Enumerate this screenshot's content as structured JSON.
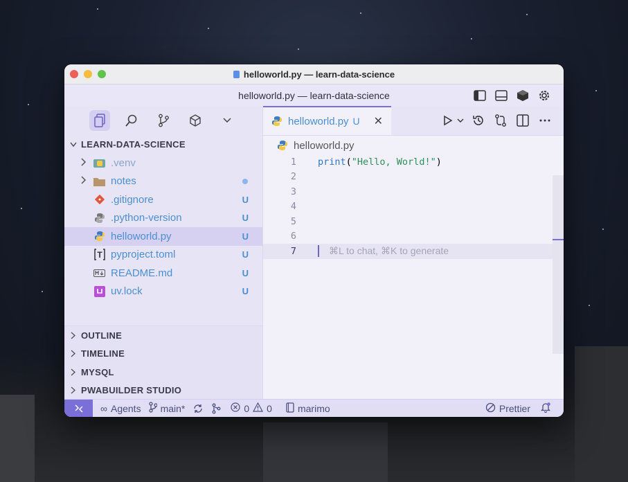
{
  "window": {
    "title": "helloworld.py — learn-data-science"
  },
  "command_center": {
    "label": "helloworld.py — learn-data-science"
  },
  "explorer": {
    "section_title": "LEARN-DATA-SCIENCE",
    "items": [
      {
        "name": ".venv",
        "badge": "",
        "type": "folder"
      },
      {
        "name": "notes",
        "badge": "",
        "type": "folder"
      },
      {
        "name": ".gitignore",
        "badge": "U",
        "type": "file"
      },
      {
        "name": ".python-version",
        "badge": "U",
        "type": "file"
      },
      {
        "name": "helloworld.py",
        "badge": "U",
        "type": "file"
      },
      {
        "name": "pyproject.toml",
        "badge": "U",
        "type": "file"
      },
      {
        "name": "README.md",
        "badge": "U",
        "type": "file"
      },
      {
        "name": "uv.lock",
        "badge": "U",
        "type": "file"
      }
    ],
    "bottom_sections": [
      "OUTLINE",
      "TIMELINE",
      "MYSQL",
      "PWABUILDER STUDIO"
    ]
  },
  "editor": {
    "tab_label": "helloworld.py",
    "tab_status": "U",
    "breadcrumb": "helloworld.py",
    "lines": [
      "1",
      "2",
      "3",
      "4",
      "5",
      "6",
      "7"
    ],
    "code_func": "print",
    "code_open": "(",
    "code_string": "\"Hello, World!\"",
    "code_close": ")",
    "hint": "⌘L to chat, ⌘K to generate"
  },
  "statusbar": {
    "agents": "Agents",
    "branch": "main*",
    "errors": "0",
    "warnings": "0",
    "kernel": "marimo",
    "formatter": "Prettier"
  },
  "colors": {
    "accent": "#7a6fd6",
    "file_text": "#4a8fd4"
  }
}
